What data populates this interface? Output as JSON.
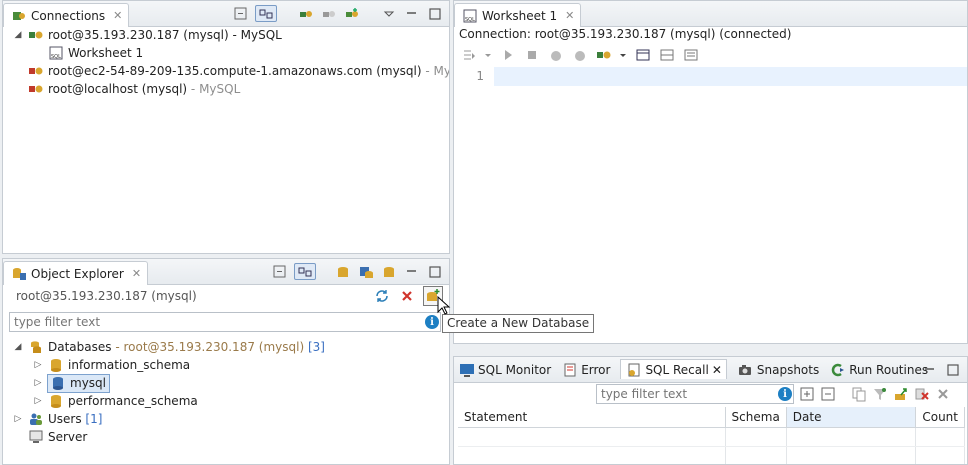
{
  "connections_panel": {
    "tab_label": "Connections",
    "tree": [
      {
        "label": "root@35.193.230.187 (mysql)",
        "suffix": " - MySQL",
        "state": "connected",
        "expanded": true
      },
      {
        "label": "Worksheet 1",
        "child": true
      },
      {
        "label": "root@ec2-54-89-209-135.compute-1.amazonaws.com (mysql)",
        "suffix": " - MySQL",
        "state": "disconnected"
      },
      {
        "label": "root@localhost (mysql)",
        "suffix": " - MySQL",
        "state": "disconnected"
      }
    ]
  },
  "worksheet": {
    "tab_label": "Worksheet 1",
    "connection_status": "Connection: root@35.193.230.187 (mysql) (connected)",
    "line_number": "1"
  },
  "object_explorer": {
    "tab_label": "Object Explorer",
    "connection": "root@35.193.230.187 (mysql)",
    "filter_placeholder": "type filter text",
    "tooltip": "Create a New Database",
    "databases_label": "Databases",
    "databases_suffix": " - root@35.193.230.187 (mysql)",
    "databases_count": " [3]",
    "databases": [
      "information_schema",
      "mysql",
      "performance_schema"
    ],
    "users_label": "Users",
    "users_count": " [1]",
    "server_label": "Server"
  },
  "bottom_panel": {
    "tabs": [
      "SQL Monitor",
      "Error",
      "SQL Recall",
      "Snapshots",
      "Run Routines"
    ],
    "filter_placeholder": "type filter text",
    "columns": [
      "Statement",
      "Schema",
      "Date",
      "Count"
    ]
  },
  "colors": {
    "accent": "#1d7fc3",
    "selected_row": "#dbe8f7"
  }
}
